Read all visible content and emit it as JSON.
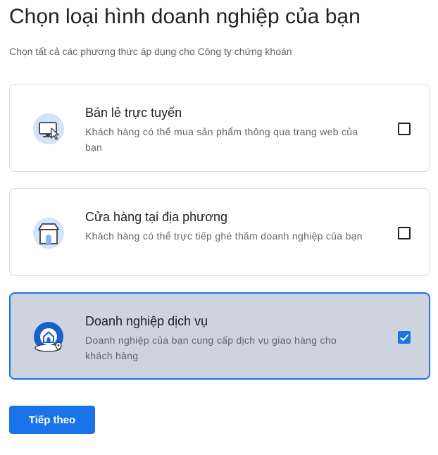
{
  "header": {
    "title": "Chọn loại hình doanh nghiệp của bạn",
    "subtitle": "Chọn tất cả các phương thức áp dụng cho Công ty chứng khoán"
  },
  "options": [
    {
      "title": "Bán lẻ trực tuyến",
      "description": "Khách hàng có thể mua sản phẩm thông qua trang web của bạn",
      "icon": "computer-cursor-icon",
      "checked": false
    },
    {
      "title": "Cửa hàng tại địa phương",
      "description": "Khách hàng có thể trực tiếp ghé thăm doanh nghiệp của bạn",
      "icon": "storefront-icon",
      "checked": false
    },
    {
      "title": "Doanh nghiệp dịch vụ",
      "description": "Doanh nghiệp của bạn cung cấp dịch vụ giao hàng cho khách hàng",
      "icon": "home-location-icon",
      "checked": true
    }
  ],
  "actions": {
    "next_label": "Tiếp theo"
  },
  "colors": {
    "accent": "#1a73e8",
    "selected_bg": "#ced4df",
    "border": "#dadce0",
    "icon_bg": "#d2e3fc"
  }
}
